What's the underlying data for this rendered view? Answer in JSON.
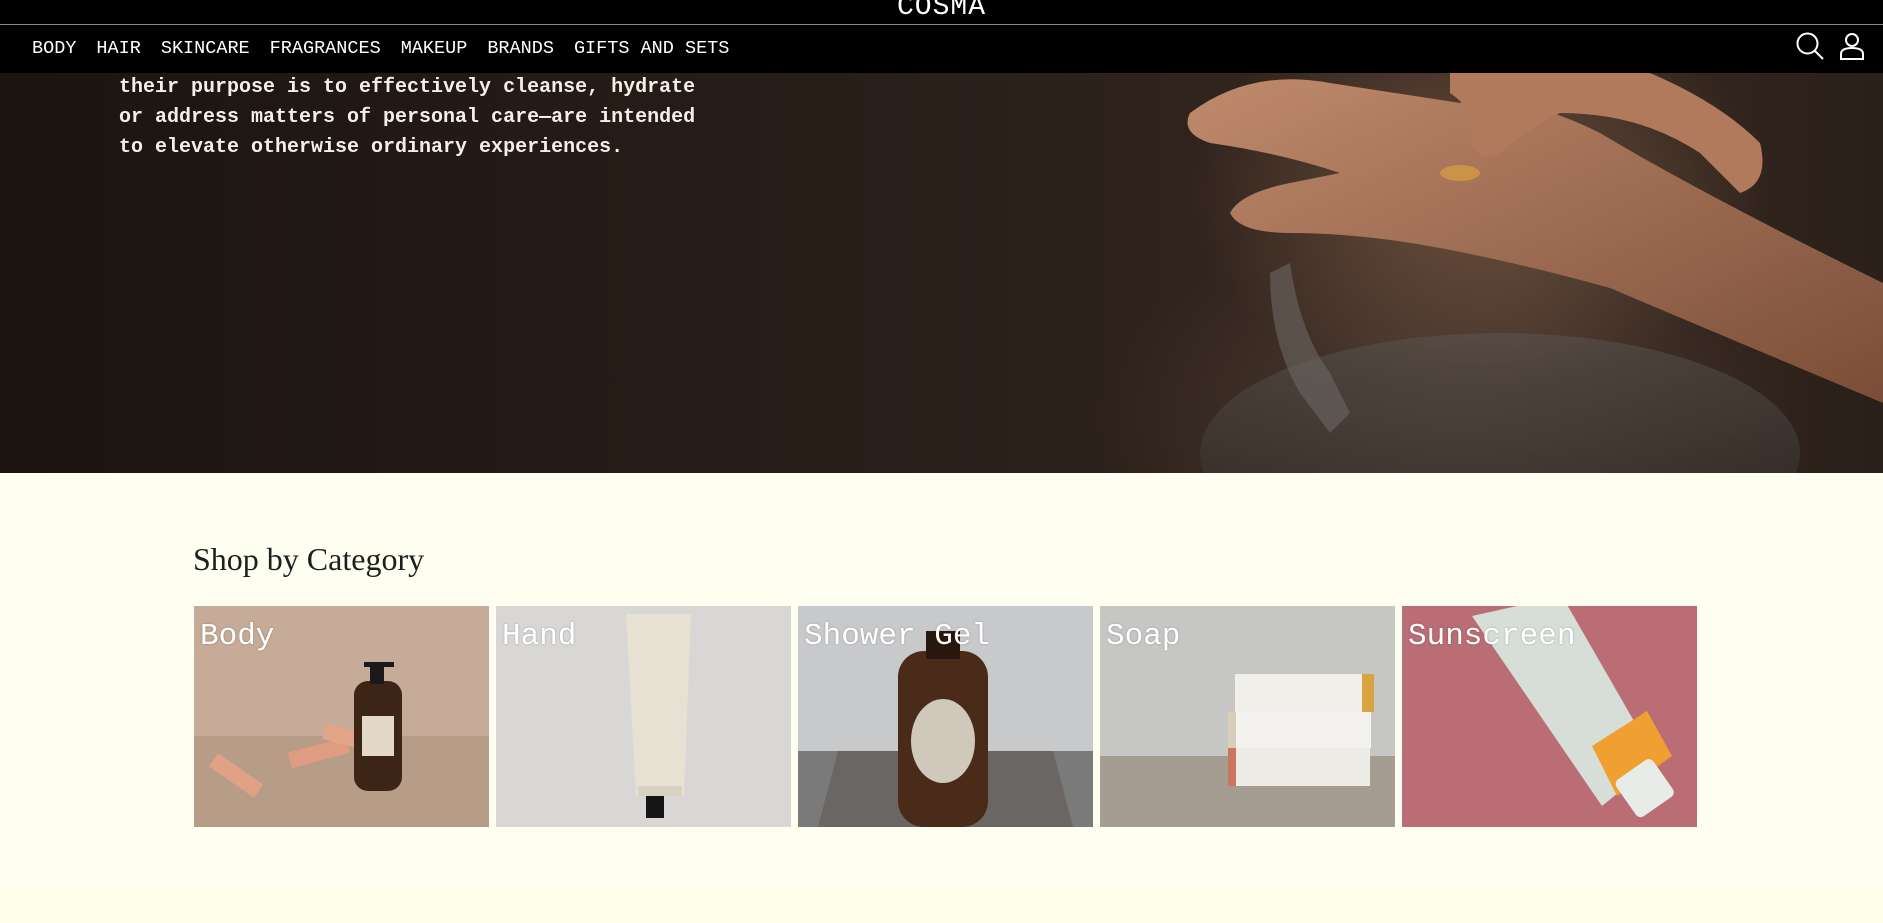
{
  "header": {
    "brand": "COSMA",
    "nav": [
      "BODY",
      "HAIR",
      "SKINCARE",
      "FRAGRANCES",
      "MAKEUP",
      "BRANDS",
      "GIFTS AND SETS"
    ],
    "icons": [
      "search-icon",
      "account-icon"
    ]
  },
  "hero": {
    "text_lines": [
      "their purpose is to effectively cleanse, hydrate",
      "or address matters of personal care—are intended",
      "to elevate otherwise ordinary experiences."
    ]
  },
  "categories": {
    "title": "Shop by Category",
    "items": [
      {
        "label": "Body"
      },
      {
        "label": "Hand"
      },
      {
        "label": "Shower Gel"
      },
      {
        "label": "Soap"
      },
      {
        "label": "Sunscreen"
      }
    ]
  },
  "colors": {
    "header_bg": "#000000",
    "page_bg": "#fefff0",
    "text_light": "#ffffff"
  }
}
